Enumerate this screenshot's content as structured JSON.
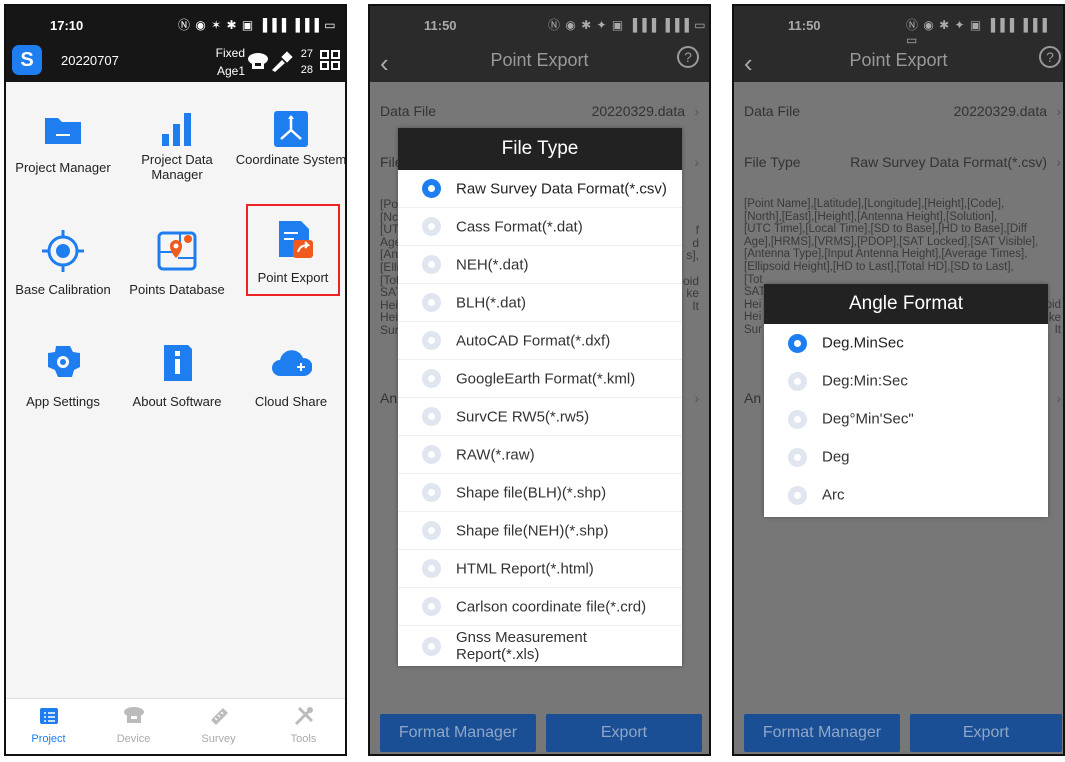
{
  "colors": {
    "accent": "#1e7ef0",
    "highlight": "#e22222",
    "dark_header": "#161616",
    "button": "#1a4f96"
  },
  "screen1": {
    "status": {
      "time": "17:10",
      "icons": "Ⓝ ◉ ✶ ✱ ▣ ▐▐▐ ▐▐▐ ▭"
    },
    "header": {
      "project": "20220707",
      "fix": "Fixed",
      "age": "Age1",
      "sat_visible": "27",
      "sat_used": "28"
    },
    "tiles": [
      {
        "label": "Project Manager",
        "icon": "folder-icon"
      },
      {
        "label": "Project Data Manager",
        "icon": "bar-chart-icon"
      },
      {
        "label": "Coordinate System",
        "icon": "coordinate-axes-icon"
      },
      {
        "label": "Base Calibration",
        "icon": "crosshair-icon"
      },
      {
        "label": "Points Database",
        "icon": "map-pin-icon"
      },
      {
        "label": "Point Export",
        "icon": "file-export-icon"
      },
      {
        "label": "App Settings",
        "icon": "gear-icon"
      },
      {
        "label": "About Software",
        "icon": "info-icon"
      },
      {
        "label": "Cloud Share",
        "icon": "cloud-icon"
      }
    ],
    "nav": [
      {
        "label": "Project",
        "icon": "list-icon"
      },
      {
        "label": "Device",
        "icon": "receiver-icon"
      },
      {
        "label": "Survey",
        "icon": "ruler-icon"
      },
      {
        "label": "Tools",
        "icon": "tools-icon"
      }
    ]
  },
  "screen2": {
    "status": {
      "time": "11:50",
      "icons": "Ⓝ ◉ ✱ ✦ ▣ ▐▐▐ ▐▐▐ ▭"
    },
    "title": "Point Export",
    "data_file_label": "Data File",
    "data_file_value": "20220329.data",
    "file_type_label": "File",
    "fields_fragment": [
      "[Po",
      "[Nc",
      "[UT",
      "Age",
      "[An",
      "[Elli",
      "[Tot",
      "SAT",
      "Hei",
      "Hei",
      "Sur"
    ],
    "fields_right": [
      "f",
      "d",
      "s],",
      "",
      "oid",
      "ke",
      "It"
    ],
    "angle_label": "An",
    "dialog_title": "File Type",
    "options": [
      "Raw Survey Data Format(*.csv)",
      "Cass Format(*.dat)",
      "NEH(*.dat)",
      "BLH(*.dat)",
      "AutoCAD Format(*.dxf)",
      "GoogleEarth Format(*.kml)",
      "SurvCE RW5(*.rw5)",
      "RAW(*.raw)",
      "Shape file(BLH)(*.shp)",
      "Shape file(NEH)(*.shp)",
      "HTML Report(*.html)",
      "Carlson coordinate file(*.crd)",
      "Gnss Measurement Report(*.xls)"
    ],
    "format_manager": "Format Manager",
    "export": "Export"
  },
  "screen3": {
    "status": {
      "time": "11:50",
      "icons": "Ⓝ ◉ ✱ ✦ ▣ ▐▐▐ ▐▐▐ ▭"
    },
    "title": "Point Export",
    "data_file_label": "Data File",
    "data_file_value": "20220329.data",
    "file_type_label": "File Type",
    "file_type_value": "Raw Survey Data Format(*.csv)",
    "fields_lines": [
      "[Point Name],[Latitude],[Longitude],[Height],[Code],",
      "[North],[East],[Height],[Antenna Height],[Solution],",
      "[UTC Time],[Local Time],[SD to Base],[HD to Base],[Diff",
      "Age],[HRMS],[VRMS],[PDOP],[SAT Locked],[SAT Visible],",
      "[Antenna Type],[Input Antenna Height],[Average Times],",
      "[Ellipsoid Height],[HD to Last],[Total HD],[SD to Last],"
    ],
    "fields_fragment": [
      "[Tot",
      "SAT",
      "Hei",
      "Hei",
      "Sur"
    ],
    "fields_right": [
      "oid",
      "ke",
      "It"
    ],
    "angle_label": "An",
    "dialog_title": "Angle Format",
    "options": [
      "Deg.MinSec",
      "Deg:Min:Sec",
      "Deg°Min'Sec\"",
      "Deg",
      "Arc"
    ],
    "format_manager": "Format Manager",
    "export": "Export"
  }
}
